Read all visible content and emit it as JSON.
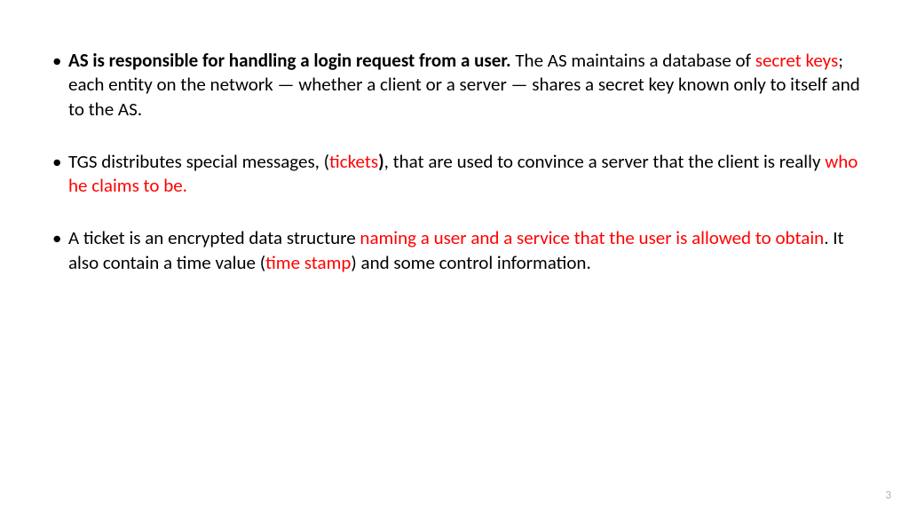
{
  "bullets": [
    {
      "segments": [
        {
          "text": "AS is responsible for handling a login request from a user. ",
          "bold": true
        },
        {
          "text": "The AS maintains a database of "
        },
        {
          "text": "secret keys",
          "red": true
        },
        {
          "text": "; each entity on the network — whether a client or a server — shares a secret key known only to itself and to the AS."
        }
      ]
    },
    {
      "segments": [
        {
          "text": " TGS distributes special messages, ("
        },
        {
          "text": "tickets",
          "red": true
        },
        {
          "text": ")",
          "bold": true
        },
        {
          "text": ", that are used to convince a server that the client is really "
        },
        {
          "text": "who he claims to be.",
          "red": true
        }
      ]
    },
    {
      "segments": [
        {
          "text": "A ticket is an encrypted data structure "
        },
        {
          "text": "naming a user and a service that the user is allowed to obtain",
          "red": true
        },
        {
          "text": ". It also contain a time value ("
        },
        {
          "text": "time stamp",
          "red": true
        },
        {
          "text": ") and some control information."
        }
      ]
    }
  ],
  "page_number": "3"
}
